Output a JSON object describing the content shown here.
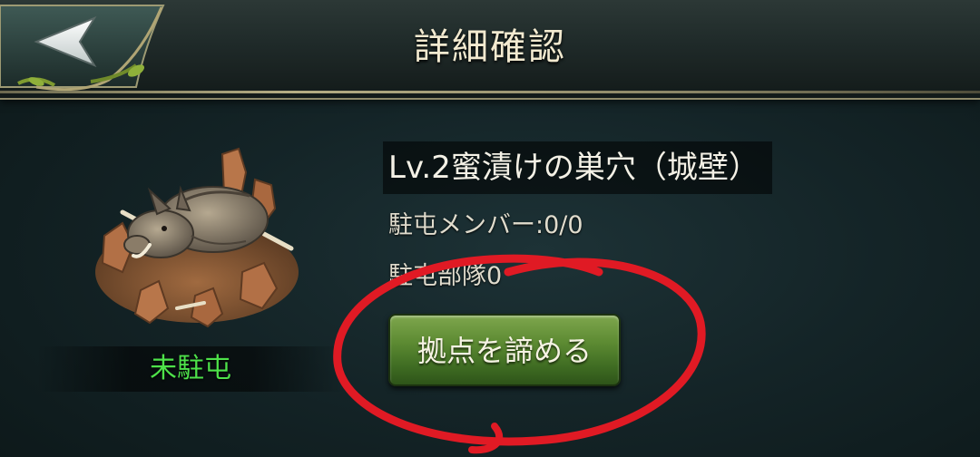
{
  "header": {
    "title": "詳細確認",
    "back_icon": "back-arrow-icon"
  },
  "base": {
    "name": "Lv.2蜜漬けの巣穴（城壁）",
    "members": "駐屯メンバー:0/0",
    "troops": "駐屯部隊0",
    "status": "未駐屯",
    "creature_icon": "boar-den-icon"
  },
  "actions": {
    "abandon_label": "拠点を諦める"
  },
  "colors": {
    "status_green": "#4ee24a",
    "button_green": "#5c8a32",
    "annotation_red": "#e01a24"
  }
}
